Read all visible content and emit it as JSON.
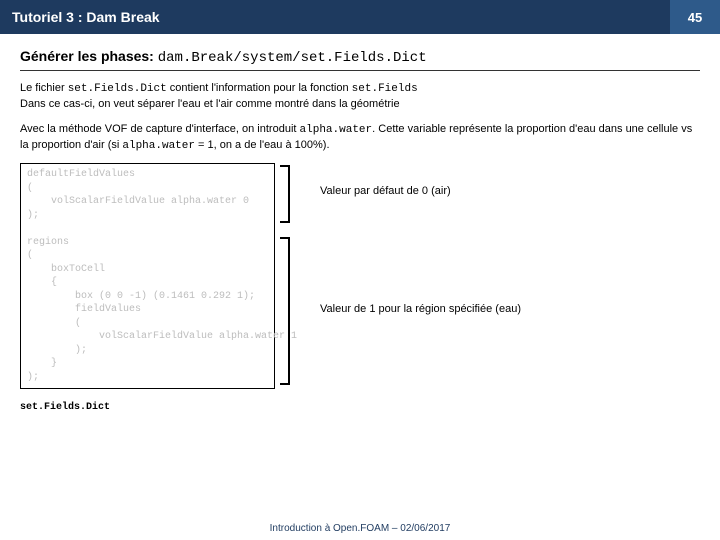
{
  "header": {
    "title": "Tutoriel 3 : Dam Break",
    "page": "45"
  },
  "subtitle": {
    "prefix": "Générer les phases: ",
    "path": "dam.Break/system/set.Fields.Dict"
  },
  "para1": {
    "t1": "Le fichier ",
    "m1": "set.Fields.Dict",
    "t2": " contient l'information pour la fonction ",
    "m2": "set.Fields",
    "t3": "Dans ce cas-ci, on veut séparer l'eau et l'air comme montré dans la géométrie"
  },
  "para2": {
    "t1": "Avec la méthode VOF de capture d'interface, on introduit ",
    "m1": "alpha.water",
    "t2": ". Cette variable représente la proportion d'eau dans une cellule vs la proportion d'air (si ",
    "m2": "alpha.water",
    "t3": " = 1, on a de l'eau à 100%)."
  },
  "code": "defaultFieldValues\n(\n    volScalarFieldValue alpha.water 0\n);\n\nregions\n(\n    boxToCell\n    {\n        box (0 0 -1) (0.1461 0.292 1);\n        fieldValues\n        (\n            volScalarFieldValue alpha.water 1\n        );\n    }\n);",
  "annotations": {
    "a1": "Valeur par défaut de 0 (air)",
    "a2": "Valeur de 1 pour la région spécifiée (eau)"
  },
  "caption": "set.Fields.Dict",
  "footer": "Introduction à Open.FOAM – 02/06/2017"
}
